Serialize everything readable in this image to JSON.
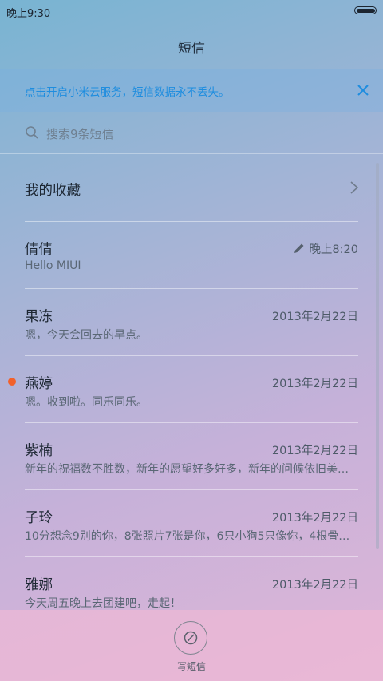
{
  "status_bar": {
    "time": "晚上9:30",
    "battery_level": 1.0
  },
  "header": {
    "title": "短信"
  },
  "banner": {
    "text": "点击开启小米云服务，短信数据永不丢失。",
    "accent": "#1e8ddf"
  },
  "search": {
    "placeholder": "搜索9条短信"
  },
  "favorites": {
    "label": "我的收藏"
  },
  "messages": [
    {
      "name": "倩倩",
      "date": "晚上8:20",
      "preview": "Hello MIUI",
      "draft": true,
      "unread": false
    },
    {
      "name": "果冻",
      "date": "2013年2月22日",
      "preview": "嗯，今天会回去的早点。",
      "draft": false,
      "unread": false
    },
    {
      "name": "燕婷",
      "date": "2013年2月22日",
      "preview": "嗯。收到啦。同乐同乐。",
      "draft": false,
      "unread": true
    },
    {
      "name": "紫楠",
      "date": "2013年2月22日",
      "preview": "新年的祝福数不胜数，新年的愿望好多好多，新年的问候依旧美…",
      "draft": false,
      "unread": false
    },
    {
      "name": "子玲",
      "date": "2013年2月22日",
      "preview": "10分想念9别的你，8张照片7张是你，6只小狗5只像你，4根骨…",
      "draft": false,
      "unread": false
    },
    {
      "name": "雅娜",
      "date": "2013年2月22日",
      "preview": "今天周五晚上去团建吧，走起！",
      "draft": false,
      "unread": false
    }
  ],
  "compose": {
    "label": "写短信"
  },
  "colors": {
    "unread_dot": "#f2612b"
  }
}
